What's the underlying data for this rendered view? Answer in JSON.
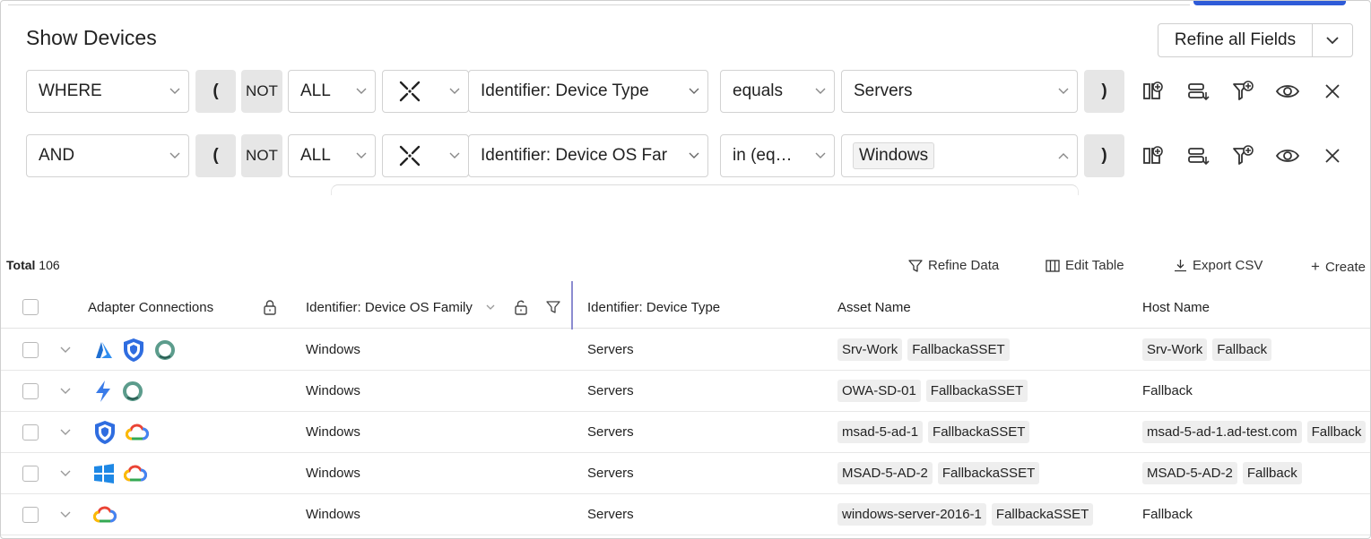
{
  "title": "Show Devices",
  "refine_all": {
    "label": "Refine all Fields"
  },
  "filters": [
    {
      "logic": "WHERE",
      "open_paren": "(",
      "not": "NOT",
      "scope": "ALL",
      "field": "Identifier: Device Type",
      "operator": "equals",
      "value": "Servers",
      "close_paren": ")"
    },
    {
      "logic": "AND",
      "open_paren": "(",
      "not": "NOT",
      "scope": "ALL",
      "field": "Identifier: Device OS Far",
      "operator": "in (eq…",
      "value": "Windows",
      "close_paren": ")"
    }
  ],
  "table": {
    "total_label": "Total",
    "total_count": "106",
    "actions": {
      "refine": "Refine Data",
      "edit": "Edit Table",
      "export": "Export CSV",
      "create": "Create"
    },
    "columns": [
      "Adapter Connections",
      "Identifier: Device OS Family",
      "Identifier: Device Type",
      "Asset Name",
      "Host Name"
    ],
    "rows": [
      {
        "adapters": [
          "azure-icon",
          "shield-icon",
          "ring-icon"
        ],
        "os": "Windows",
        "type": "Servers",
        "asset": [
          "Srv-Work",
          "FallbackaSSET"
        ],
        "host": [
          "Srv-Work",
          "Fallback"
        ],
        "host_tagged": true
      },
      {
        "adapters": [
          "bolt-icon",
          "ring-icon"
        ],
        "os": "Windows",
        "type": "Servers",
        "asset": [
          "OWA-SD-01",
          "FallbackaSSET"
        ],
        "host": [
          "Fallback"
        ],
        "host_tagged": false
      },
      {
        "adapters": [
          "shield-icon",
          "cloud-icon"
        ],
        "os": "Windows",
        "type": "Servers",
        "asset": [
          "msad-5-ad-1",
          "FallbackaSSET"
        ],
        "host": [
          "msad-5-ad-1.ad-test.com",
          "Fallback"
        ],
        "host_tagged": true
      },
      {
        "adapters": [
          "windows-icon",
          "cloud-icon"
        ],
        "os": "Windows",
        "type": "Servers",
        "asset": [
          "MSAD-5-AD-2",
          "FallbackaSSET"
        ],
        "host": [
          "MSAD-5-AD-2",
          "Fallback"
        ],
        "host_tagged": true
      },
      {
        "adapters": [
          "cloud-icon"
        ],
        "os": "Windows",
        "type": "Servers",
        "asset": [
          "windows-server-2016-1",
          "FallbackaSSET"
        ],
        "host": [
          "Fallback"
        ],
        "host_tagged": false
      }
    ]
  },
  "colors": {
    "accent": "#2e5bd8",
    "column_separator": "#8c8cd0",
    "tag_bg": "#eeeeee",
    "button_grey": "#e6e6e6"
  }
}
